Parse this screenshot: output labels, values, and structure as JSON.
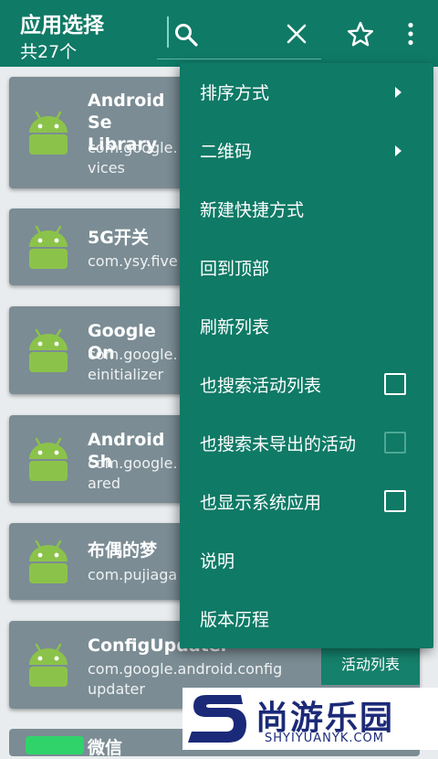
{
  "toolbar": {
    "title": "应用选择",
    "subtitle": "共27个"
  },
  "icons": {
    "search": "search-icon",
    "clear": "close-icon",
    "favorite": "star-icon",
    "more": "more-vert-icon",
    "app": "android-icon"
  },
  "apps": [
    {
      "name": "Android Se\nLibrary",
      "package": "com.google.\nvices"
    },
    {
      "name": "5G开关",
      "package": "com.ysy.five"
    },
    {
      "name": "Google On",
      "package": "com.google.\neinitializer"
    },
    {
      "name": "Android Sh",
      "package": "com.google.\nared"
    },
    {
      "name": "布偶的梦",
      "package": "com.pujiaga"
    },
    {
      "name": "ConfigUpdater",
      "package": "com.google.android.config\nupdater",
      "action": "活动列表"
    },
    {
      "name": "微信",
      "package": ""
    }
  ],
  "menu": {
    "items": [
      {
        "label": "排序方式",
        "type": "submenu"
      },
      {
        "label": "二维码",
        "type": "submenu"
      },
      {
        "label": "新建快捷方式",
        "type": "action"
      },
      {
        "label": "回到顶部",
        "type": "action"
      },
      {
        "label": "刷新列表",
        "type": "action"
      },
      {
        "label": "也搜索活动列表",
        "type": "checkbox",
        "checked": false,
        "enabled": true
      },
      {
        "label": "也搜索未导出的活动",
        "type": "checkbox",
        "checked": false,
        "enabled": false
      },
      {
        "label": "也显示系统应用",
        "type": "checkbox",
        "checked": false,
        "enabled": true
      },
      {
        "label": "说明",
        "type": "action"
      },
      {
        "label": "版本历程",
        "type": "action"
      }
    ]
  },
  "watermark": {
    "text": "尚游乐园",
    "url": "SHYIYUANYK.COM"
  },
  "colors": {
    "primary": "#0f7a66",
    "card": "#7b8c94",
    "android_green": "#8bc34a",
    "watermark_blue": "#1b2a78"
  }
}
